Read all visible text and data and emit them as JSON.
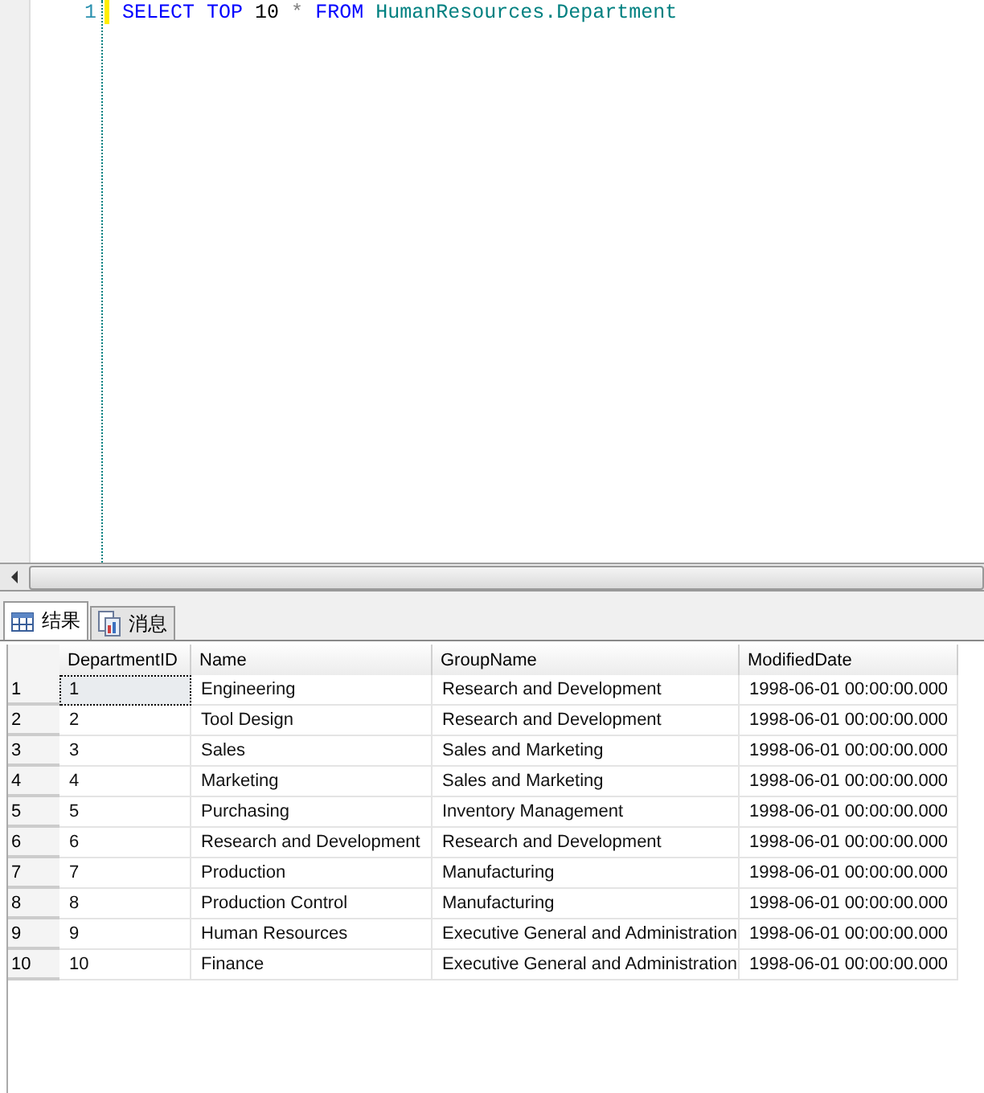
{
  "editor": {
    "lines": [
      {
        "number": "1",
        "tokens": [
          {
            "text": "SELECT",
            "kind": "keyword"
          },
          {
            "text": "TOP",
            "kind": "keyword"
          },
          {
            "text": "10",
            "kind": "plain"
          },
          {
            "text": "*",
            "kind": "operator"
          },
          {
            "text": "FROM",
            "kind": "keyword"
          },
          {
            "text": "HumanResources.Department",
            "kind": "identifier"
          }
        ]
      }
    ]
  },
  "tabs": [
    {
      "label": "结果",
      "kind": "grid",
      "selected": true
    },
    {
      "label": "消息",
      "kind": "messages",
      "selected": false
    }
  ],
  "table": {
    "columns": [
      "DepartmentID",
      "Name",
      "GroupName",
      "ModifiedDate"
    ],
    "rows": [
      {
        "number": "1",
        "focused": true,
        "cells": [
          "1",
          "Engineering",
          "Research and Development",
          "1998-06-01 00:00:00.000"
        ]
      },
      {
        "number": "2",
        "focused": false,
        "cells": [
          "2",
          "Tool Design",
          "Research and Development",
          "1998-06-01 00:00:00.000"
        ]
      },
      {
        "number": "3",
        "focused": false,
        "cells": [
          "3",
          "Sales",
          "Sales and Marketing",
          "1998-06-01 00:00:00.000"
        ]
      },
      {
        "number": "4",
        "focused": false,
        "cells": [
          "4",
          "Marketing",
          "Sales and Marketing",
          "1998-06-01 00:00:00.000"
        ]
      },
      {
        "number": "5",
        "focused": false,
        "cells": [
          "5",
          "Purchasing",
          "Inventory Management",
          "1998-06-01 00:00:00.000"
        ]
      },
      {
        "number": "6",
        "focused": false,
        "cells": [
          "6",
          "Research and Development",
          "Research and Development",
          "1998-06-01 00:00:00.000"
        ]
      },
      {
        "number": "7",
        "focused": false,
        "cells": [
          "7",
          "Production",
          "Manufacturing",
          "1998-06-01 00:00:00.000"
        ]
      },
      {
        "number": "8",
        "focused": false,
        "cells": [
          "8",
          "Production Control",
          "Manufacturing",
          "1998-06-01 00:00:00.000"
        ]
      },
      {
        "number": "9",
        "focused": false,
        "cells": [
          "9",
          "Human Resources",
          "Executive General and Administration",
          "1998-06-01 00:00:00.000"
        ]
      },
      {
        "number": "10",
        "focused": false,
        "cells": [
          "10",
          "Finance",
          "Executive General and Administration",
          "1998-06-01 00:00:00.000"
        ]
      }
    ]
  }
}
